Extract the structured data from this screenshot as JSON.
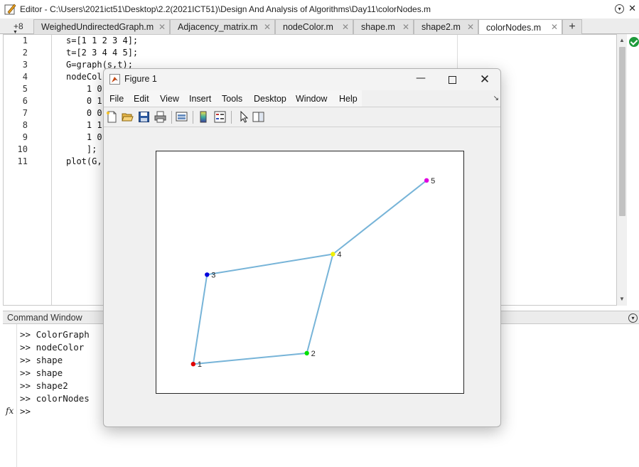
{
  "editor": {
    "title": "Editor - C:\\Users\\2021ict51\\Desktop\\2.2(2021ICT51)\\Design And Analysis of Algorithms\\Day11\\colorNodes.m",
    "more_tabs_label": "+8",
    "tabs": [
      {
        "label": "WeighedUndirectedGraph.m",
        "active": false
      },
      {
        "label": "Adjacency_matrix.m",
        "active": false
      },
      {
        "label": "nodeColor.m",
        "active": false
      },
      {
        "label": "shape.m",
        "active": false
      },
      {
        "label": "shape2.m",
        "active": false
      },
      {
        "label": "colorNodes.m",
        "active": true
      }
    ],
    "add_tab_label": "+",
    "lines": [
      {
        "num": "1",
        "code": "s=[1 1 2 3 4];"
      },
      {
        "num": "2",
        "code": "t=[2 3 4 4 5];"
      },
      {
        "num": "3",
        "code": "G=graph(s,t);"
      },
      {
        "num": "4",
        "code": "nodeCol"
      },
      {
        "num": "5",
        "code": "    1 0"
      },
      {
        "num": "6",
        "code": "    0 1"
      },
      {
        "num": "7",
        "code": "    0 0"
      },
      {
        "num": "8",
        "code": "    1 1"
      },
      {
        "num": "9",
        "code": "    1 0"
      },
      {
        "num": "10",
        "code": "    ];"
      },
      {
        "num": "11",
        "code": "plot(G,"
      }
    ],
    "status_color": "#1e9a3b"
  },
  "command_window": {
    "title": "Command Window",
    "lines": [
      ">> ColorGraph",
      ">> nodeColor",
      ">> shape",
      ">> shape",
      ">> shape2",
      ">> colorNodes",
      ">>"
    ],
    "fx_label": "fx"
  },
  "figure": {
    "title": "Figure 1",
    "menu": [
      "File",
      "Edit",
      "View",
      "Insert",
      "Tools",
      "Desktop",
      "Window",
      "Help"
    ],
    "toolbar_icons": [
      "new-figure-icon",
      "open-file-icon",
      "save-icon",
      "print-icon",
      "link-plot-icon",
      "colorbar-icon",
      "legend-icon",
      "pointer-icon",
      "property-inspector-icon"
    ],
    "chart_data": {
      "type": "scatter",
      "description_type": "graph",
      "edge_color": "#77b4d8",
      "nodes": [
        {
          "label": "1",
          "x": 0.12,
          "y": 0.12,
          "color": "#e00000"
        },
        {
          "label": "2",
          "x": 0.49,
          "y": 0.165,
          "color": "#00e000"
        },
        {
          "label": "3",
          "x": 0.165,
          "y": 0.49,
          "color": "#0000dd"
        },
        {
          "label": "4",
          "x": 0.575,
          "y": 0.575,
          "color": "#f0f000"
        },
        {
          "label": "5",
          "x": 0.88,
          "y": 0.88,
          "color": "#e000e0"
        }
      ],
      "edges": [
        [
          "1",
          "2"
        ],
        [
          "1",
          "3"
        ],
        [
          "2",
          "4"
        ],
        [
          "3",
          "4"
        ],
        [
          "4",
          "5"
        ]
      ]
    }
  }
}
